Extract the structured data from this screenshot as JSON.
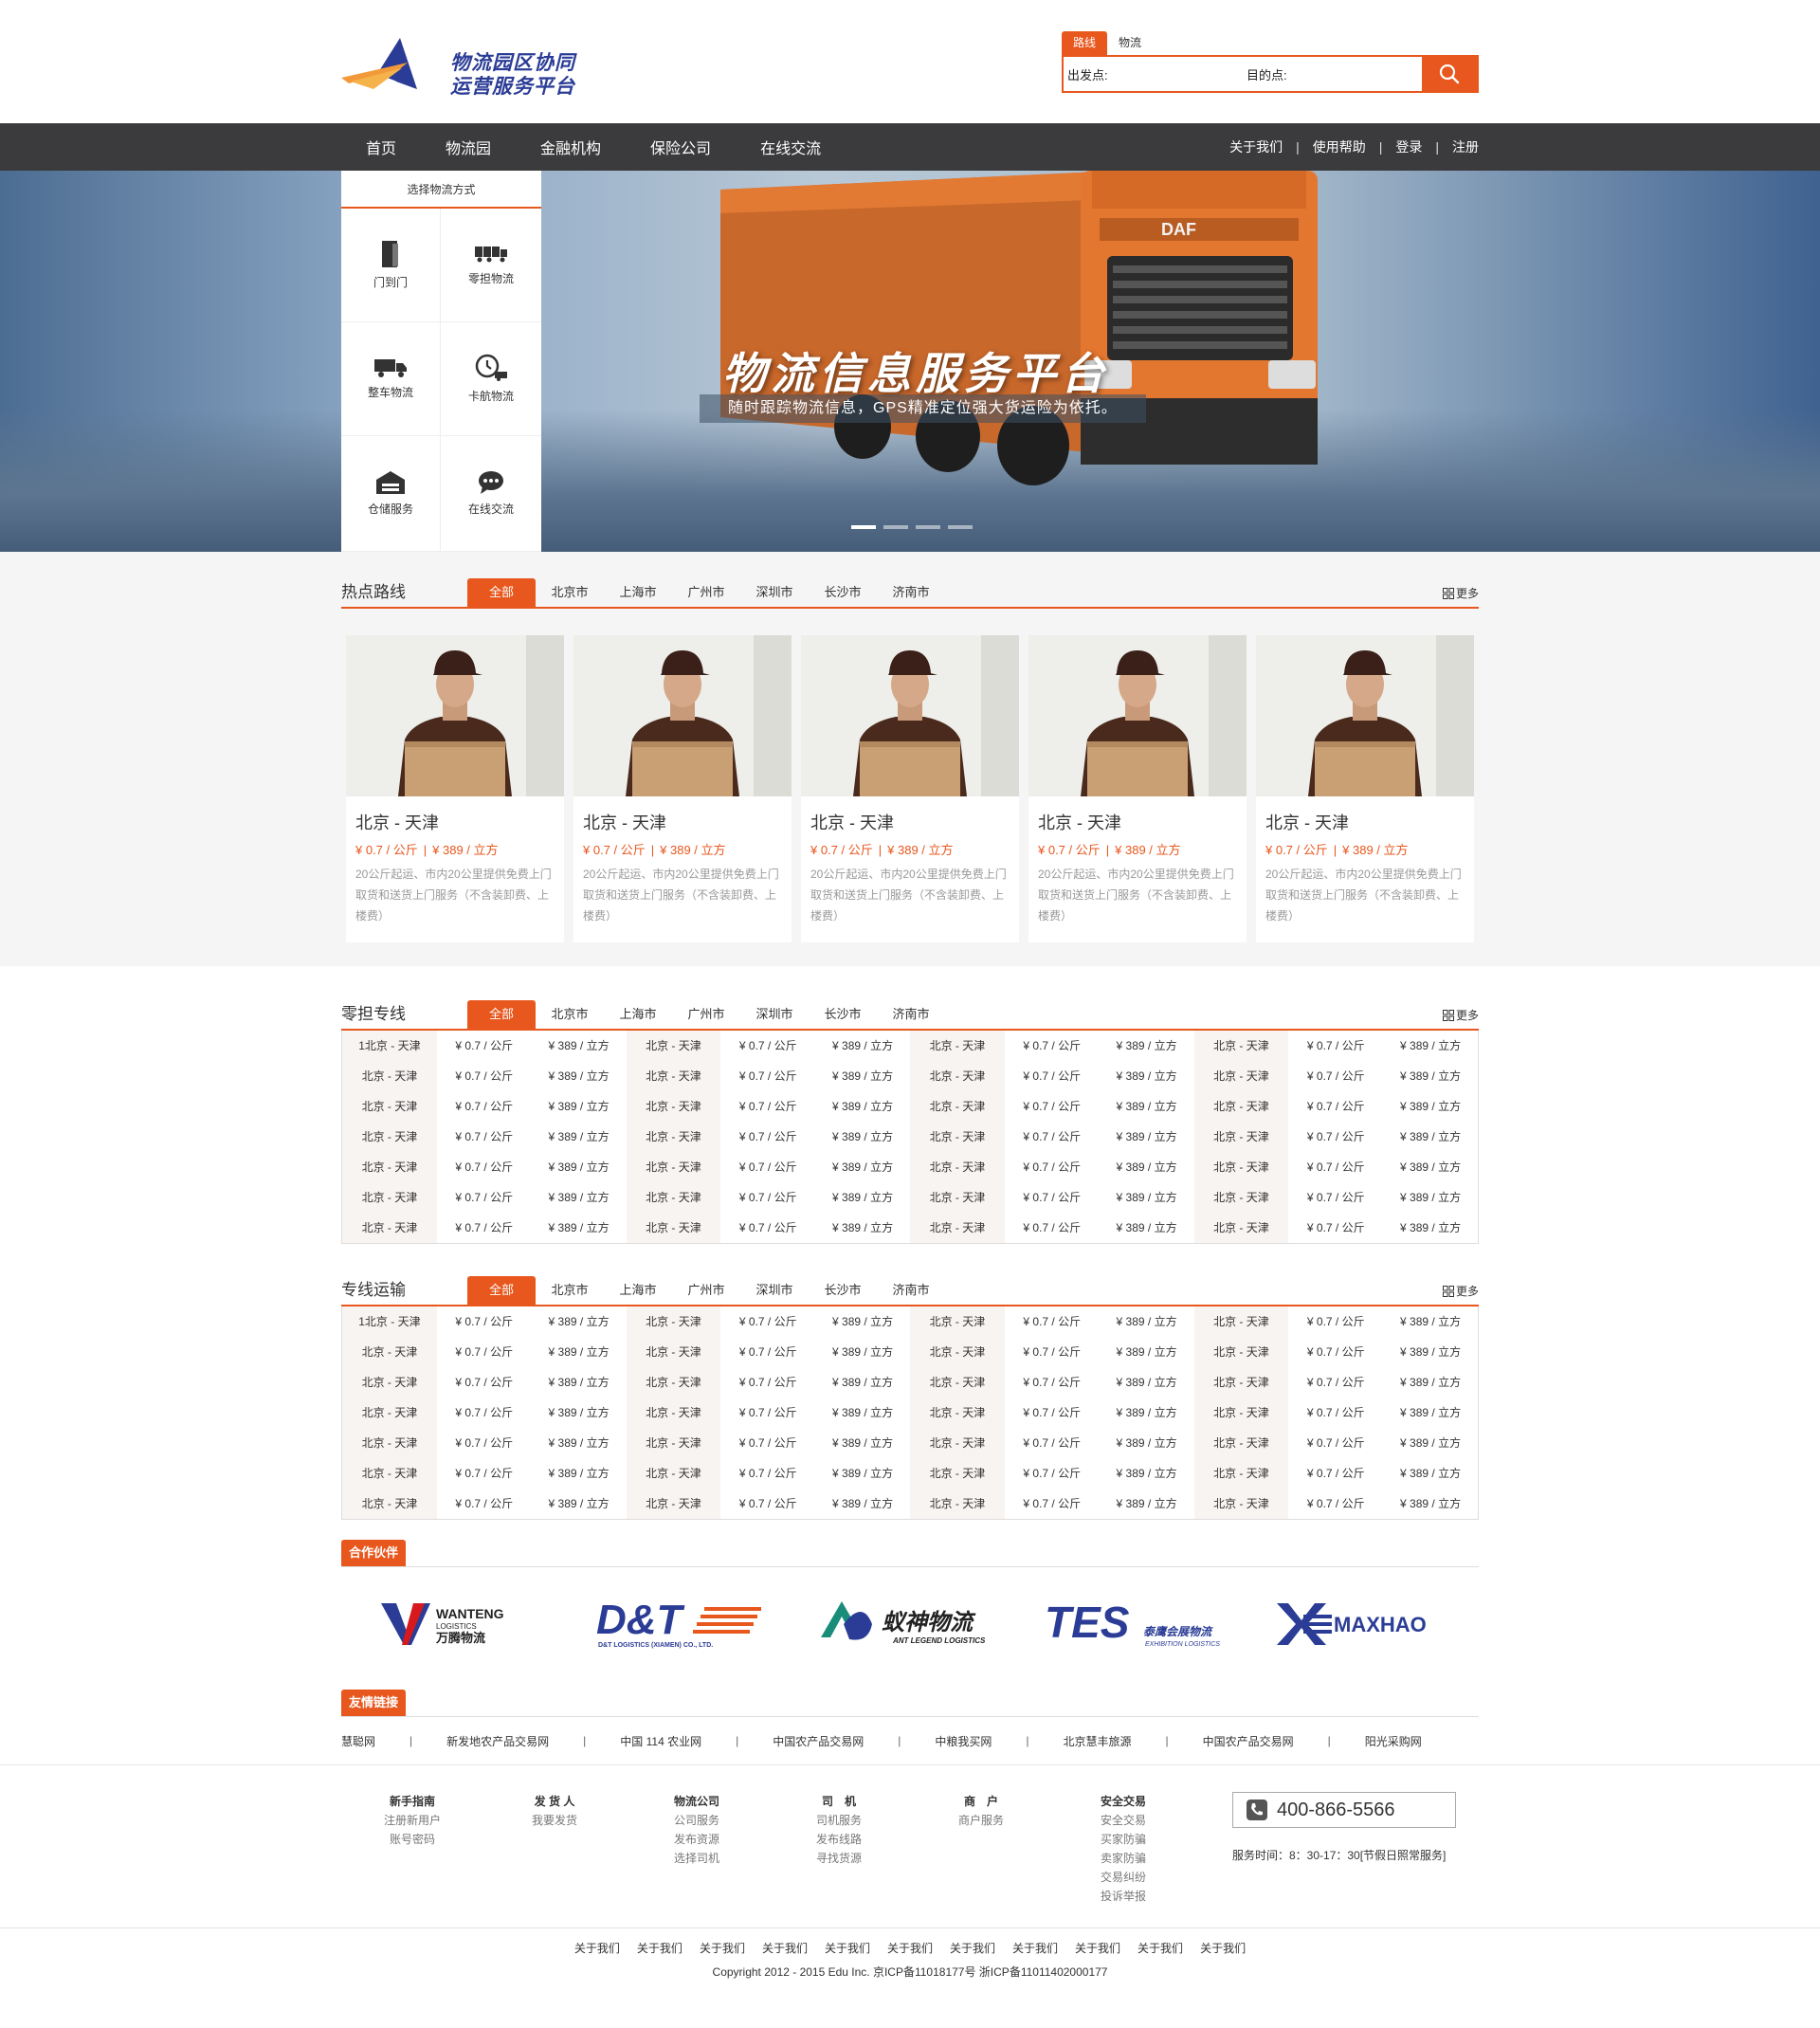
{
  "brand": {
    "logo_line1": "物流园区协同",
    "logo_line2": "运营服务平台",
    "accent": "#e8571d",
    "nav_bg": "#3b3b3d",
    "logo_blue": "#2b3c96"
  },
  "search": {
    "tabs": [
      "路线",
      "物流"
    ],
    "from_label": "出发点:",
    "to_label": "目的点:",
    "from_placeholder": "",
    "to_placeholder": "",
    "button_icon": "search-icon"
  },
  "nav": {
    "items": [
      "首页",
      "物流园",
      "金融机构",
      "保险公司",
      "在线交流"
    ],
    "right": [
      "关于我们",
      "使用帮助",
      "登录",
      "注册"
    ]
  },
  "banner": {
    "title": "物流信息服务平台",
    "subtitle": "随时跟踪物流信息，GPS精准定位强大货运险为依托。",
    "slide_count": 4,
    "active_slide": 1
  },
  "ship_panel": {
    "title": "选择物流方式",
    "items": [
      {
        "label": "门到门",
        "icon": "door-icon"
      },
      {
        "label": "零担物流",
        "icon": "freight-train-icon"
      },
      {
        "label": "整车物流",
        "icon": "truck-icon"
      },
      {
        "label": "卡航物流",
        "icon": "clock-truck-icon"
      },
      {
        "label": "仓储服务",
        "icon": "warehouse-icon"
      },
      {
        "label": "在线交流",
        "icon": "chat-icon"
      }
    ]
  },
  "tabs_cities": [
    "全部",
    "北京市",
    "上海市",
    "广州市",
    "深圳市",
    "长沙市",
    "济南市"
  ],
  "more_label": "更多",
  "hot_routes": {
    "title": "热点路线",
    "cards": [
      {
        "route": "北京 - 天津",
        "price_kg": "¥ 0.7 / 公斤",
        "price_m3": "¥ 389 / 立方",
        "desc": "20公斤起运、市内20公里提供免费上门取货和送货上门服务（不含装卸费、上楼费）"
      },
      {
        "route": "北京 - 天津",
        "price_kg": "¥ 0.7 / 公斤",
        "price_m3": "¥ 389 / 立方",
        "desc": "20公斤起运、市内20公里提供免费上门取货和送货上门服务（不含装卸费、上楼费）"
      },
      {
        "route": "北京 - 天津",
        "price_kg": "¥ 0.7 / 公斤",
        "price_m3": "¥ 389 / 立方",
        "desc": "20公斤起运、市内20公里提供免费上门取货和送货上门服务（不含装卸费、上楼费）"
      },
      {
        "route": "北京 - 天津",
        "price_kg": "¥ 0.7 / 公斤",
        "price_m3": "¥ 389 / 立方",
        "desc": "20公斤起运、市内20公里提供免费上门取货和送货上门服务（不含装卸费、上楼费）"
      },
      {
        "route": "北京 - 天津",
        "price_kg": "¥ 0.7 / 公斤",
        "price_m3": "¥ 389 / 立方",
        "desc": "20公斤起运、市内20公里提供免费上门取货和送货上门服务（不含装卸费、上楼费）"
      }
    ]
  },
  "ltl": {
    "title": "零担专线",
    "first_cell": "1北京 - 天津",
    "city": "北京 - 天津",
    "kg": "¥ 0.7 / 公斤",
    "m3": "¥ 389 / 立方",
    "rows": 7
  },
  "dedicated": {
    "title": "专线运输",
    "first_cell": "1北京 - 天津",
    "city": "北京 - 天津",
    "kg": "¥ 0.7 / 公斤",
    "m3": "¥ 389 / 立方",
    "rows": 7
  },
  "partners": {
    "title": "合作伙伴",
    "items": [
      {
        "name": "WANTENG",
        "sub1": "LOGISTICS",
        "sub2": "万腾物流"
      },
      {
        "name": "D&T",
        "sub1": "D&T LOGISTICS (XIAMEN) CO., LTD.",
        "sub2": ""
      },
      {
        "name": "蚁神物流",
        "sub1": "ANT LEGEND LOGISTICS",
        "sub2": ""
      },
      {
        "name": "TES",
        "sub1": "泰鹰会展物流",
        "sub2": "EXHIBITION LOGISTICS"
      },
      {
        "name": "MAXHAO",
        "sub1": "",
        "sub2": ""
      }
    ]
  },
  "friend_links": {
    "title": "友情链接",
    "items": [
      "慧聪网",
      "新发地农产品交易网",
      "中国 114 农业网",
      "中国农产品交易网",
      "中粮我买网",
      "北京慧丰旅源",
      "中国农产品交易网",
      "阳光采购网"
    ]
  },
  "footer": {
    "columns": [
      {
        "head": "新手指南",
        "links": [
          "注册新用户",
          "账号密码"
        ]
      },
      {
        "head": "发 货 人",
        "links": [
          "我要发货"
        ]
      },
      {
        "head": "物流公司",
        "links": [
          "公司服务",
          "发布资源",
          "选择司机"
        ]
      },
      {
        "head": "司　机",
        "links": [
          "司机服务",
          "发布线路",
          "寻找货源"
        ]
      },
      {
        "head": "商　户",
        "links": [
          "商户服务"
        ]
      },
      {
        "head": "安全交易",
        "links": [
          "安全交易",
          "买家防骗",
          "卖家防骗",
          "交易纠纷",
          "投诉举报"
        ]
      }
    ],
    "hotline": "400-866-5566",
    "service_time": "服务时间：8：30-17：30[节假日照常服务]"
  },
  "bottom": {
    "links": [
      "关于我们",
      "关于我们",
      "关于我们",
      "关于我们",
      "关于我们",
      "关于我们",
      "关于我们",
      "关于我们",
      "关于我们",
      "关于我们",
      "关于我们"
    ],
    "copyright": "Copyright 2012 - 2015 Edu Inc. 京ICP备11018177号 浙ICP备11011402000177"
  }
}
